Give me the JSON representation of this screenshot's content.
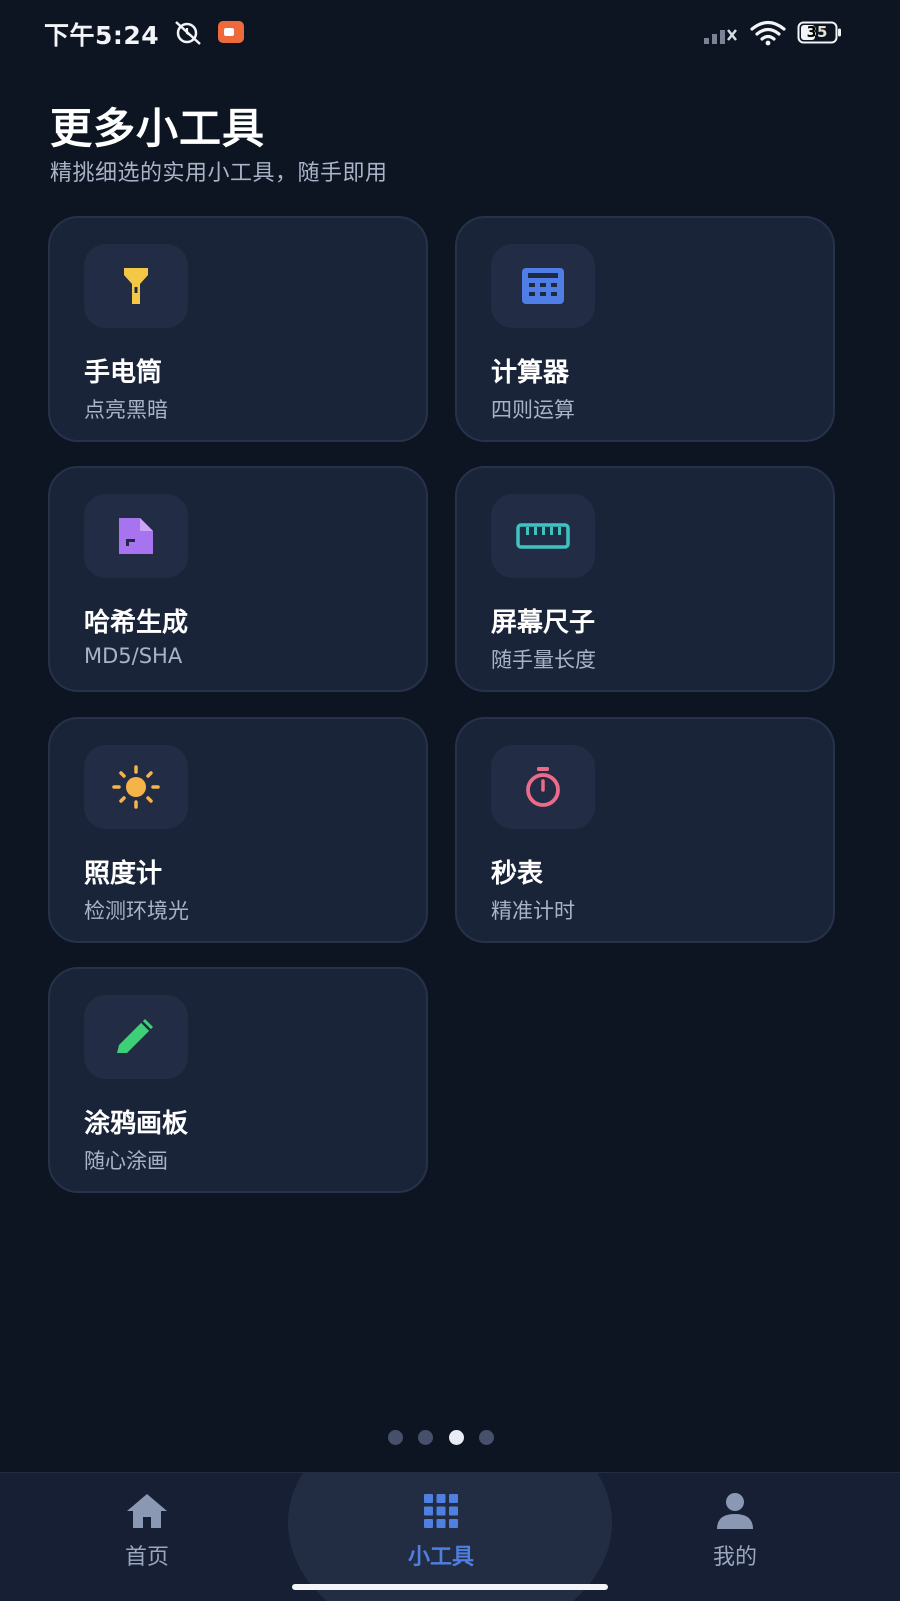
{
  "status_bar": {
    "time": "下午5:24",
    "battery": "35",
    "icons": [
      "alarm-off-icon",
      "screen-record-icon",
      "signal-icon",
      "wifi-icon",
      "battery-icon"
    ]
  },
  "header": {
    "title": "更多小工具",
    "subtitle": "精挑细选的实用小工具，随手即用"
  },
  "tools": [
    {
      "title": "手电筒",
      "subtitle": "点亮黑暗",
      "icon": "flashlight-icon",
      "color": "#f3c845"
    },
    {
      "title": "计算器",
      "subtitle": "四则运算",
      "icon": "calculator-icon",
      "color": "#4f7fe6"
    },
    {
      "title": "哈希生成",
      "subtitle": "MD5/SHA",
      "icon": "file-hash-icon",
      "color": "#a873ee"
    },
    {
      "title": "屏幕尺子",
      "subtitle": "随手量长度",
      "icon": "ruler-icon",
      "color": "#3ec4c0"
    },
    {
      "title": "照度计",
      "subtitle": "检测环境光",
      "icon": "sun-icon",
      "color": "#f6b348"
    },
    {
      "title": "秒表",
      "subtitle": "精准计时",
      "icon": "stopwatch-icon",
      "color": "#ec6a8a"
    },
    {
      "title": "涂鸦画板",
      "subtitle": "随心涂画",
      "icon": "pencil-icon",
      "color": "#3fcf78"
    }
  ],
  "pager": {
    "count": 4,
    "active": 3
  },
  "nav": {
    "items": [
      {
        "label": "首页",
        "icon": "home-icon"
      },
      {
        "label": "小工具",
        "icon": "grid-icon"
      },
      {
        "label": "我的",
        "icon": "person-icon"
      }
    ],
    "active_index": 1,
    "accent": "#4f7fe0"
  }
}
